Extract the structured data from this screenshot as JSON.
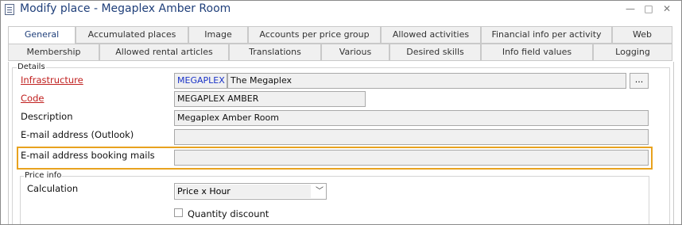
{
  "window": {
    "title": "Modify place - Megaplex Amber Room",
    "minimize_glyph": "—",
    "maximize_glyph": "□",
    "close_glyph": "✕"
  },
  "tabs_row1": [
    {
      "label": "General",
      "active": true
    },
    {
      "label": "Accumulated places"
    },
    {
      "label": "Image"
    },
    {
      "label": "Accounts per price group"
    },
    {
      "label": "Allowed activities"
    },
    {
      "label": "Financial info per activity"
    },
    {
      "label": "Web"
    }
  ],
  "tabs_row2": [
    {
      "label": "Membership"
    },
    {
      "label": "Allowed rental articles"
    },
    {
      "label": "Translations"
    },
    {
      "label": "Various"
    },
    {
      "label": "Desired skills"
    },
    {
      "label": "Info field values"
    },
    {
      "label": "Logging"
    }
  ],
  "details": {
    "group_title": "Details",
    "infrastructure": {
      "label": "Infrastructure",
      "code": "MEGAPLEX",
      "name": "The Megaplex",
      "browse_label": "..."
    },
    "code": {
      "label": "Code",
      "value": "MEGAPLEX AMBER"
    },
    "description": {
      "label": "Description",
      "value": "Megaplex Amber Room"
    },
    "email_outlook": {
      "label": "E-mail address (Outlook)",
      "value": ""
    },
    "email_booking": {
      "label": "E-mail address booking mails",
      "value": ""
    }
  },
  "price_info": {
    "group_title": "Price info",
    "calculation": {
      "label": "Calculation",
      "selected": "Price x Hour"
    },
    "quantity_discount": {
      "label": "Quantity discount",
      "checked": false
    }
  },
  "colors": {
    "title": "#1f3f7a",
    "required_label": "#c0201f",
    "highlight": "#e8a21e",
    "code_text": "#1a33c8"
  }
}
